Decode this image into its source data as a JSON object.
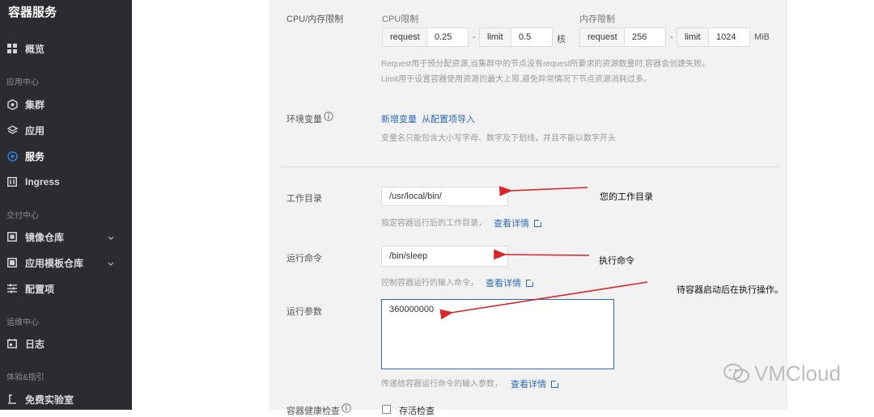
{
  "sidebar": {
    "title": "容器服务",
    "overview": "概览",
    "group_app": "应用中心",
    "cluster": "集群",
    "app": "应用",
    "service": "服务",
    "ingress": "Ingress",
    "group_delivery": "交付中心",
    "image_repo": "镜像仓库",
    "template_repo": "应用模板仓库",
    "config": "配置项",
    "group_ops": "运维中心",
    "log": "日志",
    "group_exp": "体验&指引",
    "lab": "免费实验室"
  },
  "form": {
    "cpu_mem_label": "CPU/内存限制",
    "cpu_limit_title": "CPU限制",
    "mem_limit_title": "内存限制",
    "cpu_request_label": "request",
    "cpu_request_value": "0.25",
    "cpu_limit_label": "limit",
    "cpu_limit_value": "0.5",
    "cpu_unit": "核",
    "mem_request_label": "request",
    "mem_request_value": "256",
    "mem_limit_label": "limit",
    "mem_limit_value": "1024",
    "mem_unit": "MiB",
    "dash": "-",
    "limit_hint1": "Request用于预分配资源,当集群中的节点没有request所要求的资源数量时,容器会创建失败。",
    "limit_hint2": "Limit用于设置容器使用资源的最大上限,避免异常情况下节点资源消耗过多。",
    "env_label": "环境变量",
    "env_add": "新增变量",
    "env_import": "从配置项导入",
    "env_hint": "变量名只能包含大小写字母、数字及下划线，并且不能以数字开头",
    "workdir_label": "工作目录",
    "workdir_value": "/usr/local/bin/",
    "workdir_hint": "指定容器运行后的工作目录，",
    "details": "查看详情",
    "cmd_label": "运行命令",
    "cmd_value": "/bin/sleep",
    "cmd_hint": "控制容器运行的输入命令，",
    "args_label": "运行参数",
    "args_value": "360000000",
    "args_hint": "传递给容器运行命令的输入参数，",
    "health_label": "容器健康检查",
    "health_check": "存活检查"
  },
  "annotations": {
    "workdir": "您的工作目录",
    "cmd": "执行命令",
    "args": "待容器启动后在执行操作。"
  },
  "watermark": "VMCloud"
}
